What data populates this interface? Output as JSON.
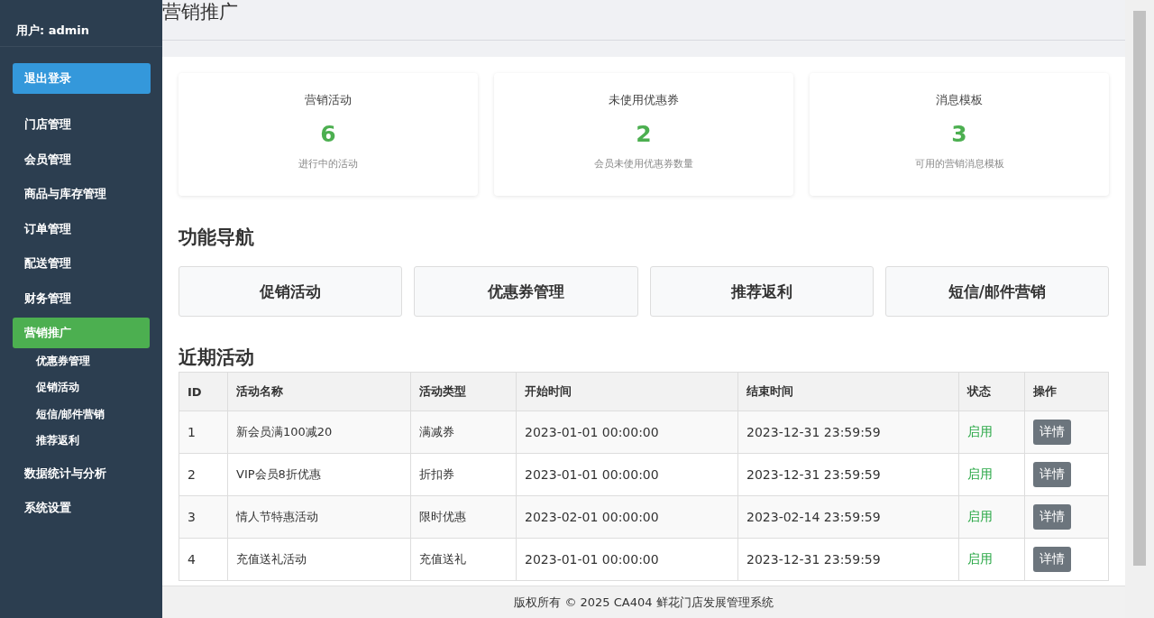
{
  "sidebar": {
    "user": "用户: admin",
    "logout": "退出登录",
    "items": [
      {
        "label": "门店管理",
        "selected": false
      },
      {
        "label": "会员管理",
        "selected": false
      },
      {
        "label": "商品与库存管理",
        "selected": false
      },
      {
        "label": "订单管理",
        "selected": false
      },
      {
        "label": "配送管理",
        "selected": false
      },
      {
        "label": "财务管理",
        "selected": false
      },
      {
        "label": "营销推广",
        "selected": true,
        "children": [
          {
            "label": "优惠券管理"
          },
          {
            "label": "促销活动"
          },
          {
            "label": "短信/邮件营销"
          },
          {
            "label": "推荐返利"
          }
        ]
      },
      {
        "label": "数据统计与分析",
        "selected": false
      },
      {
        "label": "系统设置",
        "selected": false
      }
    ]
  },
  "page_title": "营销推广",
  "stats": [
    {
      "title": "营销活动",
      "value": "6",
      "caption": "进行中的活动"
    },
    {
      "title": "未使用优惠券",
      "value": "2",
      "caption": "会员未使用优惠券数量"
    },
    {
      "title": "消息模板",
      "value": "3",
      "caption": "可用的营销消息模板"
    }
  ],
  "nav_heading": "功能导航",
  "nav_buttons": [
    "促销活动",
    "优惠券管理",
    "推荐返利",
    "短信/邮件营销"
  ],
  "recent_heading": "近期活动",
  "table": {
    "columns": [
      "ID",
      "活动名称",
      "活动类型",
      "开始时间",
      "结束时间",
      "状态",
      "操作"
    ],
    "rows": [
      {
        "id": "1",
        "name": "新会员满100减20",
        "type": "满减券",
        "start": "2023-01-01 00:00:00",
        "end": "2023-12-31 23:59:59",
        "status": "启用",
        "action": "详情"
      },
      {
        "id": "2",
        "name": "VIP会员8折优惠",
        "type": "折扣券",
        "start": "2023-01-01 00:00:00",
        "end": "2023-12-31 23:59:59",
        "status": "启用",
        "action": "详情"
      },
      {
        "id": "3",
        "name": "情人节特惠活动",
        "type": "限时优惠",
        "start": "2023-02-01 00:00:00",
        "end": "2023-02-14 23:59:59",
        "status": "启用",
        "action": "详情"
      },
      {
        "id": "4",
        "name": "充值送礼活动",
        "type": "充值送礼",
        "start": "2023-01-01 00:00:00",
        "end": "2023-12-31 23:59:59",
        "status": "启用",
        "action": "详情"
      }
    ]
  },
  "footer": "版权所有 © 2025 CA404 鲜花门店发展管理系统"
}
